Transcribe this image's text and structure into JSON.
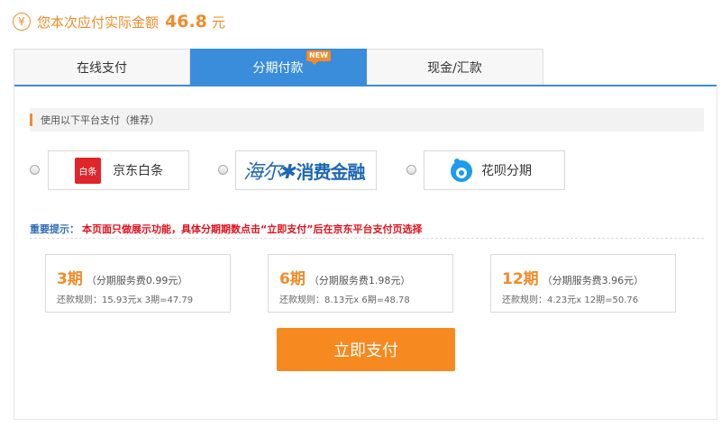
{
  "header": {
    "currency_symbol": "¥",
    "amount_label": "您本次应付实际金额",
    "amount_value": "46.8",
    "amount_unit": "元"
  },
  "tabs": [
    {
      "label": "在线支付",
      "active": false
    },
    {
      "label": "分期付款",
      "active": true,
      "badge": "NEW"
    },
    {
      "label": "现金/汇款",
      "active": false
    }
  ],
  "section": {
    "title": "使用以下平台支付（推荐）"
  },
  "platforms": [
    {
      "logo_text": "白条",
      "label": "京东白条",
      "icon": "jd-baitiao-icon"
    },
    {
      "logo_text_a": "海尔",
      "logo_text_b": "消费金融",
      "icon": "haier-consumer-finance-logo"
    },
    {
      "label": "花呗分期",
      "icon": "huabei-icon"
    }
  ],
  "notice": {
    "label": "重要提示：",
    "message": "本页面只做展示功能，具体分期期数点击“立即支付”后在京东平台支付页选择"
  },
  "plans": [
    {
      "term": "3期",
      "fee": "（分期服务费0.99元）",
      "rule": "还款规则：15.93元x 3期=47.79"
    },
    {
      "term": "6期",
      "fee": "（分期服务费1.98元）",
      "rule": "还款规则：8.13元x 6期=48.78"
    },
    {
      "term": "12期",
      "fee": "（分期服务费3.96元）",
      "rule": "还款规则：4.23元x 12期=50.76"
    }
  ],
  "actions": {
    "pay_now": "立即支付"
  },
  "colors": {
    "accent_orange": "#f08c2a",
    "tab_blue": "#3a8ddb",
    "warning_red": "#e4101b"
  }
}
